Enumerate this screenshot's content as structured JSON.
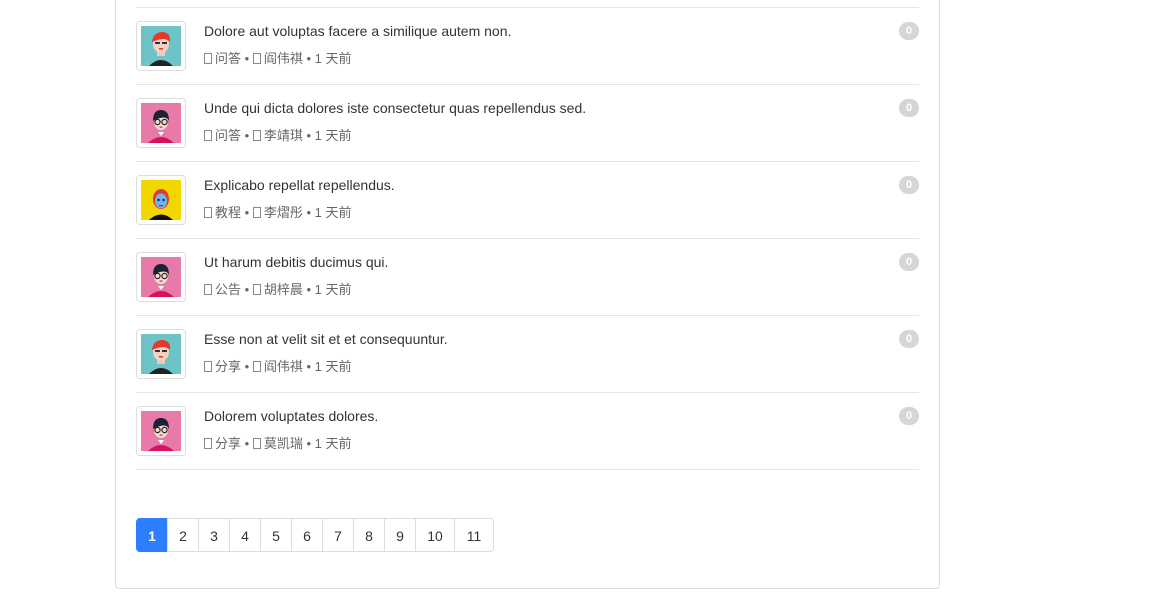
{
  "topics": [
    {
      "title": "Dolore aut voluptas facere a similique autem non.",
      "category": "问答",
      "author": "阎伟祺",
      "time": "1 天前",
      "replies": "0",
      "avatar": "teal-redhair"
    },
    {
      "title": "Unde qui dicta dolores iste consectetur quas repellendus sed.",
      "category": "问答",
      "author": "李靖琪",
      "time": "1 天前",
      "replies": "0",
      "avatar": "pink-glasses"
    },
    {
      "title": "Explicabo repellat repellendus.",
      "category": "教程",
      "author": "李熠彤",
      "time": "1 天前",
      "replies": "0",
      "avatar": "yellow-bluefaced"
    },
    {
      "title": "Ut harum debitis ducimus qui.",
      "category": "公告",
      "author": "胡梓晨",
      "time": "1 天前",
      "replies": "0",
      "avatar": "pink-glasses"
    },
    {
      "title": "Esse non at velit sit et et consequuntur.",
      "category": "分享",
      "author": "阎伟祺",
      "time": "1 天前",
      "replies": "0",
      "avatar": "teal-redhair"
    },
    {
      "title": "Dolorem voluptates dolores.",
      "category": "分享",
      "author": "莫凯瑞",
      "time": "1 天前",
      "replies": "0",
      "avatar": "pink-glasses"
    }
  ],
  "separator": "•",
  "pagination": {
    "pages": [
      "1",
      "2",
      "3",
      "4",
      "5",
      "6",
      "7",
      "8",
      "9",
      "10",
      "11"
    ],
    "active": "1"
  },
  "colors": {
    "accent": "#2d7fff",
    "badge": "#d6d6d6"
  }
}
